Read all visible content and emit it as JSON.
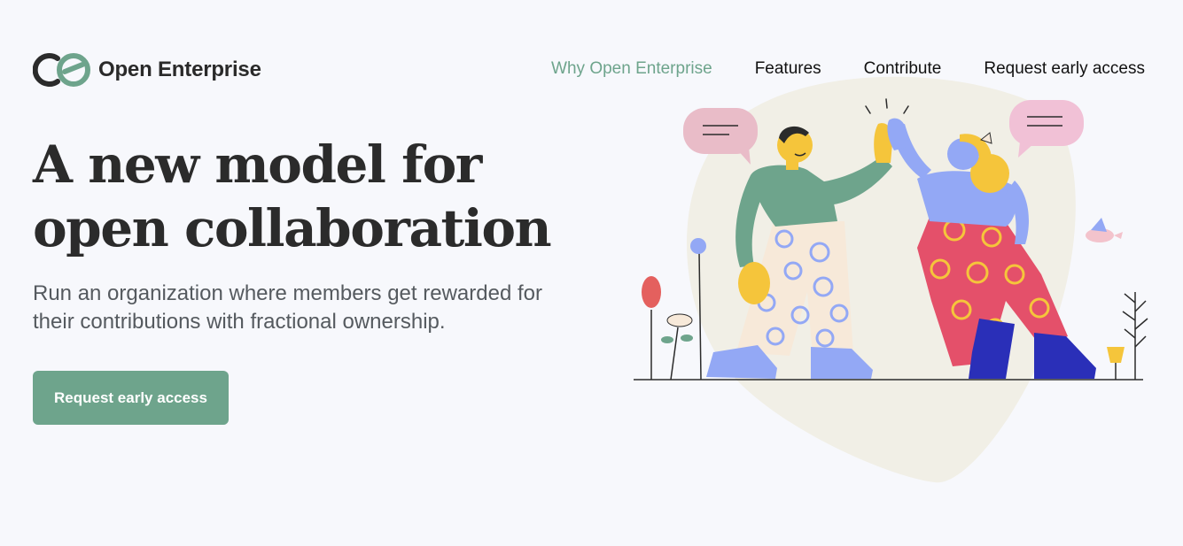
{
  "header": {
    "logo_text": "Open Enterprise",
    "logo_icon": "oe-logo-icon",
    "nav": [
      {
        "label": "Why Open Enterprise",
        "active": true
      },
      {
        "label": "Features",
        "active": false
      },
      {
        "label": "Contribute",
        "active": false
      },
      {
        "label": "Request early access",
        "active": false
      }
    ]
  },
  "hero": {
    "headline_line1": "A new model for",
    "headline_line2": "open collaboration",
    "subheadline": "Run an organization where members get rewarded for their contributions with fractional ownership.",
    "cta_label": "Request early access",
    "illustration": "people-high-five-illustration"
  },
  "colors": {
    "accent": "#6ea48c",
    "background": "#f7f8fc",
    "text": "#2b2b2b"
  }
}
